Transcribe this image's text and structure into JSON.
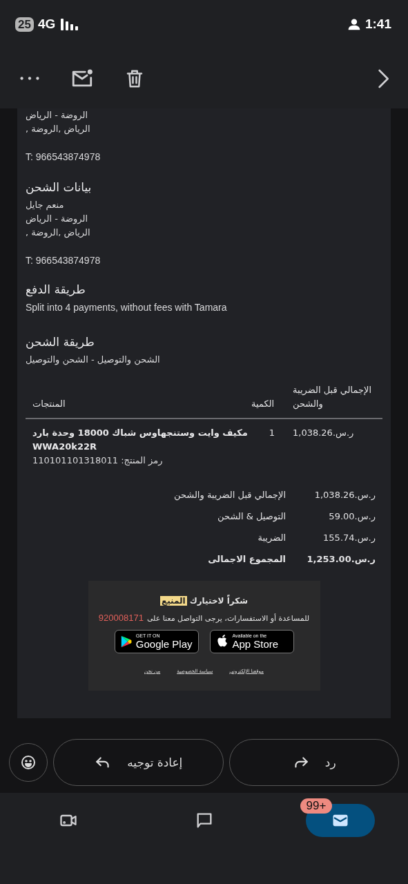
{
  "status_bar": {
    "battery": "25",
    "network": "4G",
    "time": "1:41"
  },
  "billing_partial": {
    "lines": [
      "الروضة - الرياض",
      "الرياض ,الروضة ,"
    ],
    "phone": "T: 966543874978"
  },
  "shipping_info": {
    "title": "بيانات الشحن",
    "lines": [
      "منعم جايل",
      "الروضة - الرياض",
      "الرياض ,الروضة ,"
    ],
    "phone": "T: 966543874978"
  },
  "payment": {
    "title": "طريقة الدفع",
    "text": "Split into 4 payments, without fees with Tamara"
  },
  "shipping_method": {
    "title": "طريقة الشحن",
    "text": "الشحن والتوصيل - الشحن والتوصيل"
  },
  "table": {
    "columns": [
      "الإجمالي قبل الضريبة والشحن",
      "الكمية",
      "المنتجات"
    ],
    "rows": [
      {
        "product": "مكيف وايت وستنجهاوس شباك 18000 وحدة بارد WWA20k22R",
        "code": "رمز المنتج: 110101101318011",
        "quantity": "1",
        "total": "ر.س.1,038.26"
      }
    ]
  },
  "summary": [
    {
      "label": "الإجمالي قبل الضريبة والشحن",
      "value": "ر.س.1,038.26",
      "bold": false
    },
    {
      "label": "التوصيل & الشحن",
      "value": "ر.س.59.00",
      "bold": false
    },
    {
      "label": "الضريبة",
      "value": "ر.س.155.74",
      "bold": false
    },
    {
      "label": "المجموع الاجمالى",
      "value": "ر.س.1,253.00",
      "bold": true
    }
  ],
  "footer": {
    "thanks": "شكراً لاختيارك",
    "brand": "المنيع",
    "contact": "للمساعدة أو الاستفسارات، يرجى التواصل معنا على",
    "phone": "920008171",
    "stores": [
      {
        "kind": "apple",
        "small": "Available on the",
        "big": "App Store"
      },
      {
        "kind": "google",
        "small": "GET IT ON",
        "big": "Google Play"
      }
    ],
    "links": [
      "موقعنا الإلكتروني",
      "سياسة الخصوصية",
      "من نحن"
    ]
  },
  "actions": [
    {
      "kind": "reply",
      "label": "رد"
    },
    {
      "kind": "forward",
      "label": "إعادة توجيه"
    }
  ],
  "nav": [
    {
      "kind": "video",
      "selected": false
    },
    {
      "kind": "chat",
      "selected": false
    },
    {
      "kind": "mail",
      "selected": true,
      "badge": "99+"
    }
  ]
}
